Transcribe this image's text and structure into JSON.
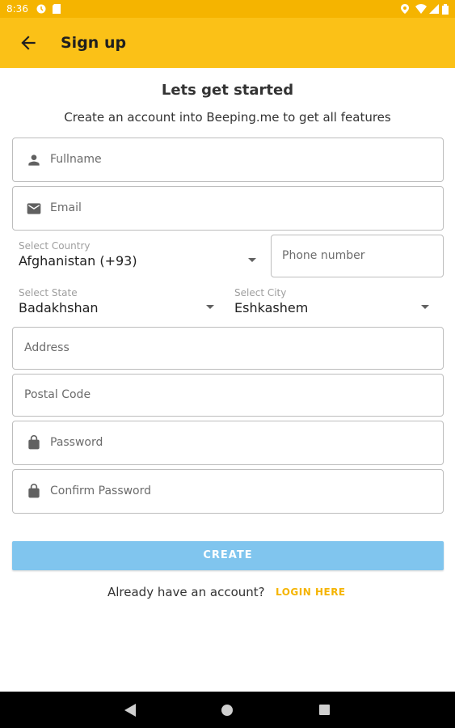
{
  "status_bar": {
    "time": "8:36",
    "icons": [
      "circle-notification-icon",
      "sim-card-icon",
      "location-icon",
      "wifi-icon",
      "signal-icon",
      "battery-icon"
    ]
  },
  "app_bar": {
    "title": "Sign up",
    "back_icon": "arrow-back-icon"
  },
  "header": {
    "title": "Lets get started",
    "subtitle": "Create an account into Beeping.me to get all features"
  },
  "form": {
    "fullname": {
      "placeholder": "Fullname",
      "icon": "person-icon"
    },
    "email": {
      "placeholder": "Email",
      "icon": "mail-icon"
    },
    "country": {
      "label": "Select Country",
      "value": "Afghanistan (+93)"
    },
    "phone": {
      "placeholder": "Phone number"
    },
    "state": {
      "label": "Select State",
      "value": "Badakhshan"
    },
    "city": {
      "label": "Select City",
      "value": "Eshkashem"
    },
    "address": {
      "placeholder": "Address"
    },
    "postal_code": {
      "placeholder": "Postal Code"
    },
    "password": {
      "placeholder": "Password",
      "icon": "lock-icon"
    },
    "confirm_password": {
      "placeholder": "Confirm Password",
      "icon": "lock-icon"
    }
  },
  "actions": {
    "create_label": "CREATE",
    "login_prompt": "Already have an account?",
    "login_link": "LOGIN HERE"
  },
  "colors": {
    "app_bar": "#FBC117",
    "status_bar": "#F5B400",
    "create_button": "#80C5EE",
    "login_link": "#F5B400"
  },
  "nav_bar": {
    "icons": [
      "back-triangle-icon",
      "home-circle-icon",
      "recents-square-icon"
    ]
  }
}
